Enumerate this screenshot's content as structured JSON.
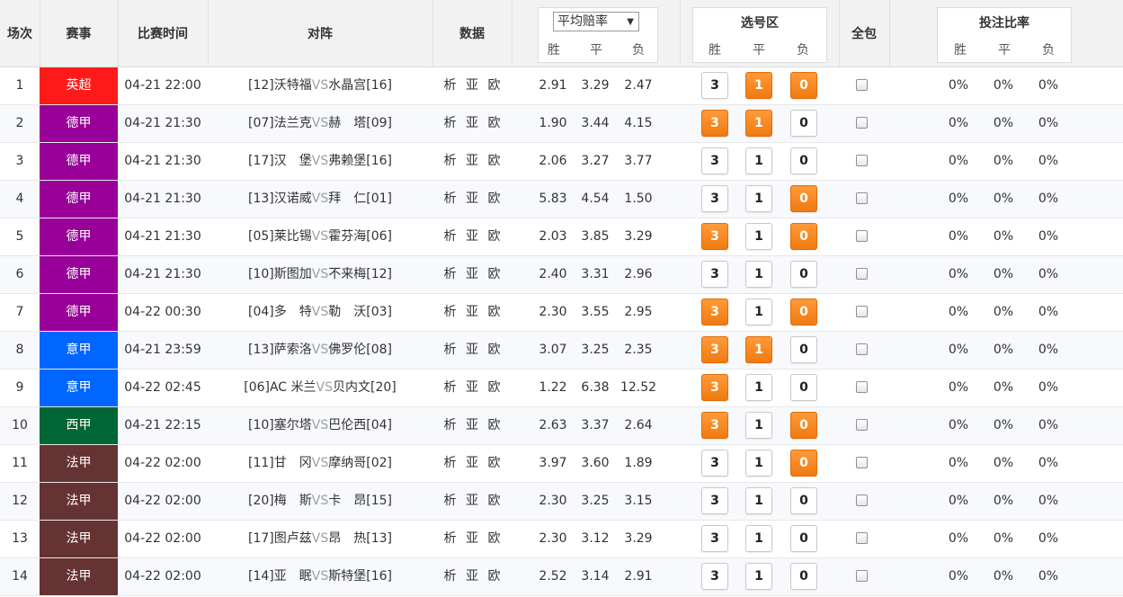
{
  "header": {
    "col_num": "场次",
    "col_league": "赛事",
    "col_time": "比赛时间",
    "col_match": "对阵",
    "col_data": "数据",
    "odds_select": "平均赔率",
    "odds_win": "胜",
    "odds_draw": "平",
    "odds_lose": "负",
    "pick_title": "选号区",
    "pick_win": "胜",
    "pick_draw": "平",
    "pick_lose": "负",
    "all_in": "全包",
    "ratio_title": "投注比率",
    "ratio_win": "胜",
    "ratio_draw": "平",
    "ratio_lose": "负"
  },
  "colors": {
    "英超": "#ff1a1a",
    "德甲": "#990099",
    "意甲": "#0066ff",
    "西甲": "#006633",
    "法甲": "#663333",
    "selected_button": "#f58220"
  },
  "data_links": [
    "析",
    "亚",
    "欧"
  ],
  "vs": "VS",
  "pick_labels": [
    "3",
    "1",
    "0"
  ],
  "rows": [
    {
      "num": "1",
      "league": "英超",
      "time": "04-21 22:00",
      "home": "[12]沃特福",
      "away": "水晶宫[16]",
      "odds": [
        "2.91",
        "3.29",
        "2.47"
      ],
      "picks": [
        false,
        true,
        true
      ],
      "ratio": [
        "0%",
        "0%",
        "0%"
      ]
    },
    {
      "num": "2",
      "league": "德甲",
      "time": "04-21 21:30",
      "home": "[07]法兰克",
      "away": "赫　塔[09]",
      "odds": [
        "1.90",
        "3.44",
        "4.15"
      ],
      "picks": [
        true,
        true,
        false
      ],
      "ratio": [
        "0%",
        "0%",
        "0%"
      ]
    },
    {
      "num": "3",
      "league": "德甲",
      "time": "04-21 21:30",
      "home": "[17]汉　堡",
      "away": "弗赖堡[16]",
      "odds": [
        "2.06",
        "3.27",
        "3.77"
      ],
      "picks": [
        false,
        false,
        false
      ],
      "ratio": [
        "0%",
        "0%",
        "0%"
      ]
    },
    {
      "num": "4",
      "league": "德甲",
      "time": "04-21 21:30",
      "home": "[13]汉诺威",
      "away": "拜　仁[01]",
      "odds": [
        "5.83",
        "4.54",
        "1.50"
      ],
      "picks": [
        false,
        false,
        true
      ],
      "ratio": [
        "0%",
        "0%",
        "0%"
      ]
    },
    {
      "num": "5",
      "league": "德甲",
      "time": "04-21 21:30",
      "home": "[05]莱比锡",
      "away": "霍芬海[06]",
      "odds": [
        "2.03",
        "3.85",
        "3.29"
      ],
      "picks": [
        true,
        false,
        true
      ],
      "ratio": [
        "0%",
        "0%",
        "0%"
      ]
    },
    {
      "num": "6",
      "league": "德甲",
      "time": "04-21 21:30",
      "home": "[10]斯图加",
      "away": "不来梅[12]",
      "odds": [
        "2.40",
        "3.31",
        "2.96"
      ],
      "picks": [
        false,
        false,
        false
      ],
      "ratio": [
        "0%",
        "0%",
        "0%"
      ]
    },
    {
      "num": "7",
      "league": "德甲",
      "time": "04-22 00:30",
      "home": "[04]多　特",
      "away": "勒　沃[03]",
      "odds": [
        "2.30",
        "3.55",
        "2.95"
      ],
      "picks": [
        true,
        false,
        true
      ],
      "ratio": [
        "0%",
        "0%",
        "0%"
      ]
    },
    {
      "num": "8",
      "league": "意甲",
      "time": "04-21 23:59",
      "home": "[13]萨索洛",
      "away": "佛罗伦[08]",
      "odds": [
        "3.07",
        "3.25",
        "2.35"
      ],
      "picks": [
        true,
        true,
        false
      ],
      "ratio": [
        "0%",
        "0%",
        "0%"
      ]
    },
    {
      "num": "9",
      "league": "意甲",
      "time": "04-22 02:45",
      "home": "[06]AC 米兰",
      "away": "贝内文[20]",
      "odds": [
        "1.22",
        "6.38",
        "12.52"
      ],
      "picks": [
        true,
        false,
        false
      ],
      "ratio": [
        "0%",
        "0%",
        "0%"
      ]
    },
    {
      "num": "10",
      "league": "西甲",
      "time": "04-21 22:15",
      "home": "[10]塞尔塔",
      "away": "巴伦西[04]",
      "odds": [
        "2.63",
        "3.37",
        "2.64"
      ],
      "picks": [
        true,
        false,
        true
      ],
      "ratio": [
        "0%",
        "0%",
        "0%"
      ]
    },
    {
      "num": "11",
      "league": "法甲",
      "time": "04-22 02:00",
      "home": "[11]甘　冈",
      "away": "摩纳哥[02]",
      "odds": [
        "3.97",
        "3.60",
        "1.89"
      ],
      "picks": [
        false,
        false,
        true
      ],
      "ratio": [
        "0%",
        "0%",
        "0%"
      ]
    },
    {
      "num": "12",
      "league": "法甲",
      "time": "04-22 02:00",
      "home": "[20]梅　斯",
      "away": "卡　昂[15]",
      "odds": [
        "2.30",
        "3.25",
        "3.15"
      ],
      "picks": [
        false,
        false,
        false
      ],
      "ratio": [
        "0%",
        "0%",
        "0%"
      ]
    },
    {
      "num": "13",
      "league": "法甲",
      "time": "04-22 02:00",
      "home": "[17]图卢兹",
      "away": "昂　热[13]",
      "odds": [
        "2.30",
        "3.12",
        "3.29"
      ],
      "picks": [
        false,
        false,
        false
      ],
      "ratio": [
        "0%",
        "0%",
        "0%"
      ]
    },
    {
      "num": "14",
      "league": "法甲",
      "time": "04-22 02:00",
      "home": "[14]亚　眠",
      "away": "斯特堡[16]",
      "odds": [
        "2.52",
        "3.14",
        "2.91"
      ],
      "picks": [
        false,
        false,
        false
      ],
      "ratio": [
        "0%",
        "0%",
        "0%"
      ]
    }
  ]
}
